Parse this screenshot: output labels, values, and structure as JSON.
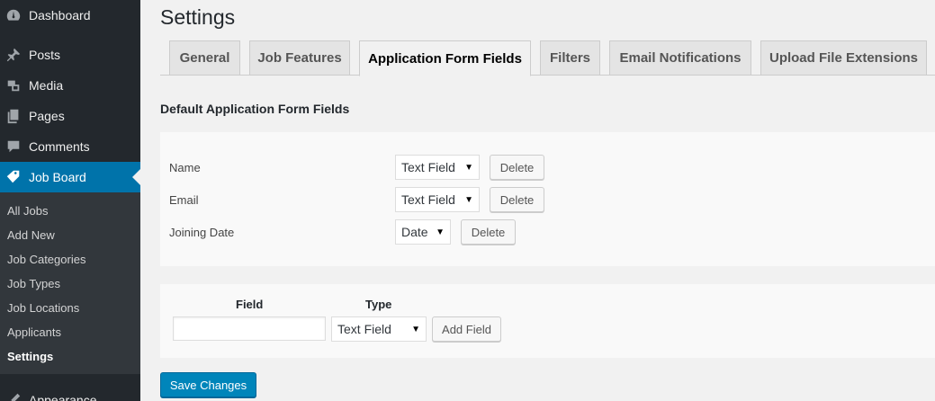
{
  "sidebar": {
    "menu": [
      {
        "label": "Dashboard",
        "icon": "dashboard-icon"
      },
      {
        "label": "Posts",
        "icon": "pin-icon"
      },
      {
        "label": "Media",
        "icon": "media-icon"
      },
      {
        "label": "Pages",
        "icon": "pages-icon"
      },
      {
        "label": "Comments",
        "icon": "comment-icon"
      },
      {
        "label": "Job Board",
        "icon": "tag-icon",
        "active": true
      },
      {
        "label": "Appearance",
        "icon": "brush-icon"
      }
    ],
    "submenu": [
      "All Jobs",
      "Add New",
      "Job Categories",
      "Job Types",
      "Job Locations",
      "Applicants",
      "Settings"
    ],
    "current_submenu": "Settings"
  },
  "page": {
    "title": "Settings"
  },
  "tabs": [
    {
      "label": "General"
    },
    {
      "label": "Job Features"
    },
    {
      "label": "Application Form Fields",
      "active": true
    },
    {
      "label": "Filters"
    },
    {
      "label": "Email Notifications"
    },
    {
      "label": "Upload File Extensions"
    }
  ],
  "section": {
    "heading": "Default Application Form Fields"
  },
  "fields": [
    {
      "name": "Name",
      "type": "Text Field",
      "delete_label": "Delete"
    },
    {
      "name": "Email",
      "type": "Text Field",
      "delete_label": "Delete"
    },
    {
      "name": "Joining Date",
      "type": "Date",
      "delete_label": "Delete"
    }
  ],
  "add_field": {
    "field_header": "Field",
    "type_header": "Type",
    "field_value": "",
    "type_value": "Text Field",
    "button_label": "Add Field"
  },
  "save_button": "Save Changes",
  "colors": {
    "sidebar_bg": "#23282d",
    "active_menu": "#0073aa",
    "primary_button": "#0085ba"
  }
}
